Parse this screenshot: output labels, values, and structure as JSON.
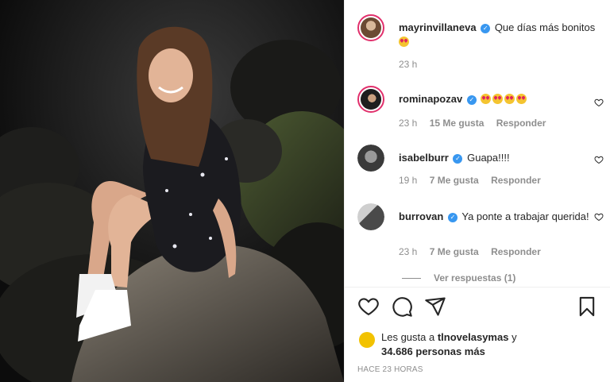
{
  "post": {
    "caption": {
      "username": "mayrinvillaneva",
      "text": "Que días más bonitos",
      "emojis": "heart-eyes-emoji",
      "time": "23 h"
    },
    "comments": [
      {
        "username": "rominapozav",
        "text": "",
        "emoji_count": 4,
        "time": "23 h",
        "likes": "15 Me gusta",
        "reply": "Responder"
      },
      {
        "username": "isabelburr",
        "text": "Guapa!!!!",
        "time": "19 h",
        "likes": "7 Me gusta",
        "reply": "Responder"
      },
      {
        "username": "burrovan",
        "text": "Ya ponte a trabajar querida!",
        "time": "23 h",
        "likes": "7 Me gusta",
        "reply": "Responder"
      }
    ],
    "view_replies": "Ver respuestas (1)",
    "liked_by_prefix": "Les gusta a",
    "liked_by_user": "tlnovelasymas",
    "liked_by_suffix": "y",
    "liked_by_count": "34.686 personas más",
    "posted_ago": "HACE 23 HORAS"
  },
  "icons": {
    "like": "heart-icon",
    "comment": "comment-icon",
    "share": "share-icon",
    "save": "bookmark-icon",
    "verified": "verified-badge-icon"
  },
  "colors": {
    "verified": "#3897f0",
    "muted": "#8e8e8e",
    "text": "#262626"
  }
}
